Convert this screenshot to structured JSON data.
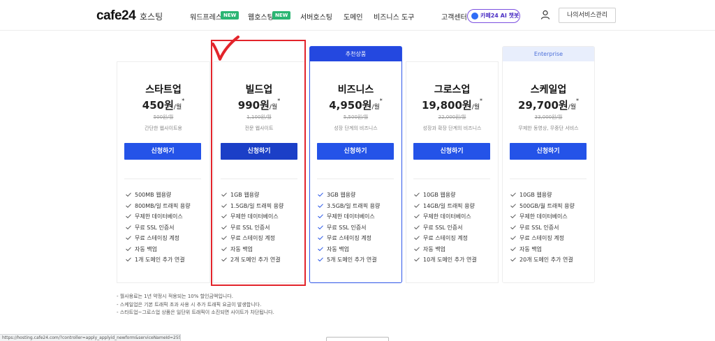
{
  "header": {
    "logo": "cafe24",
    "logo_sub": "호스팅",
    "nav": [
      {
        "label": "워드프레스",
        "badge": "NEW"
      },
      {
        "label": "웹호스팅",
        "badge": "NEW"
      },
      {
        "label": "서버호스팅"
      },
      {
        "label": "도메인"
      },
      {
        "label": "비즈니스 도구"
      },
      {
        "label": "고객센터"
      }
    ],
    "ai_chat": "카페24 AI 챗봇",
    "my_service": "나의서비스관리"
  },
  "plans": [
    {
      "name": "스타트업",
      "price": "450원",
      "unit": "/월",
      "star": "*",
      "old_price": "500원/월",
      "desc": "간단한 웹사이트용",
      "button": "신청하기",
      "features": [
        "500MB 웹용량",
        "800MB/일 트래픽 용량",
        "무제한 데이터베이스",
        "무료 SSL 인증서",
        "무료 스테이징 계정",
        "자동 백업",
        "1개 도메인 추가 연결"
      ]
    },
    {
      "name": "빌드업",
      "price": "990원",
      "unit": "/월",
      "star": "*",
      "old_price": "1,100원/월",
      "desc": "전문 웹사이트",
      "button": "신청하기",
      "features": [
        "1GB 웹용량",
        "1.5GB/일 트래픽 용량",
        "무제한 데이터베이스",
        "무료 SSL 인증서",
        "무료 스테이징 계정",
        "자동 백업",
        "2개 도메인 추가 연결"
      ]
    },
    {
      "tag": "추천상품",
      "name": "비즈니스",
      "price": "4,950원",
      "unit": "/월",
      "star": "*",
      "old_price": "5,500원/월",
      "desc": "성장 단계의 비즈니스",
      "button": "신청하기",
      "features": [
        "3GB 웹용량",
        "3.5GB/일 트래픽 용량",
        "무제한 데이터베이스",
        "무료 SSL 인증서",
        "무료 스테이징 계정",
        "자동 백업",
        "5개 도메인 추가 연결"
      ]
    },
    {
      "name": "그로스업",
      "price": "19,800원",
      "unit": "/월",
      "star": "*",
      "old_price": "22,000원/월",
      "desc": "성장과 확장 단계의 비즈니스",
      "button": "신청하기",
      "features": [
        "10GB 웹용량",
        "14GB/일 트래픽 용량",
        "무제한 데이터베이스",
        "무료 SSL 인증서",
        "무료 스테이징 계정",
        "자동 백업",
        "10개 도메인 추가 연결"
      ]
    },
    {
      "tag": "Enterprise",
      "name": "스케일업",
      "price": "29,700원",
      "unit": "/월",
      "star": "*",
      "old_price": "33,000원/월",
      "desc": "무제한 동영상, 무중단 서비스",
      "button": "신청하기",
      "features": [
        "10GB 웹용량",
        "500GB/월 트래픽 용량",
        "무제한 데이터베이스",
        "무료 SSL 인증서",
        "무료 스테이징 계정",
        "자동 백업",
        "20개 도메인 추가 연결"
      ]
    }
  ],
  "notes": [
    "- 월사용료는 1년 약정시 적용되는 10% 할인금액입니다.",
    "- 스케일업은 기본 트래픽 초과 사용 시 추가 트래픽 요금이 발생합니다.",
    "- 스타트업~그로스업 상품은 일단위 트래픽이 소진되면 사이트가 차단됩니다."
  ],
  "status_url": "https://hosting.cafe24.com/?controller=apply_applyid_newform&serviceNameId=2551",
  "colors": {
    "primary": "#2453e8",
    "primary_dark": "#1b3fc7",
    "highlight_border": "#2f56e8",
    "new_badge": "#2bb573",
    "annotation_red": "#e3242b"
  }
}
